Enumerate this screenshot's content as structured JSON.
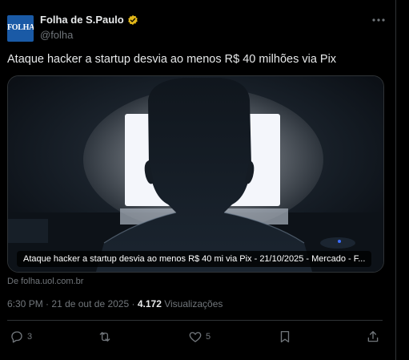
{
  "tweet": {
    "avatar_text": "FOLHA",
    "display_name": "Folha de S.Paulo",
    "handle": "@folha",
    "text": "Ataque hacker a startup desvia ao menos R$ 40 milhões via Pix",
    "media_caption": "Ataque hacker a startup desvia ao menos R$ 40 mi via Pix - 21/10/2025 - Mercado - F...",
    "source": "De folha.uol.com.br",
    "time": "6:30 PM",
    "date": "21 de out de 2025",
    "views_count": "4.172",
    "views_label": "Visualizações"
  },
  "actions": {
    "reply_count": "3",
    "retweet_count": "",
    "like_count": "5"
  },
  "colors": {
    "background": "#000000",
    "text": "#e7e9ea",
    "muted": "#71767b",
    "border": "#2f3336",
    "verified_gold": "#e2b719",
    "avatar_blue": "#1a5aa6"
  }
}
